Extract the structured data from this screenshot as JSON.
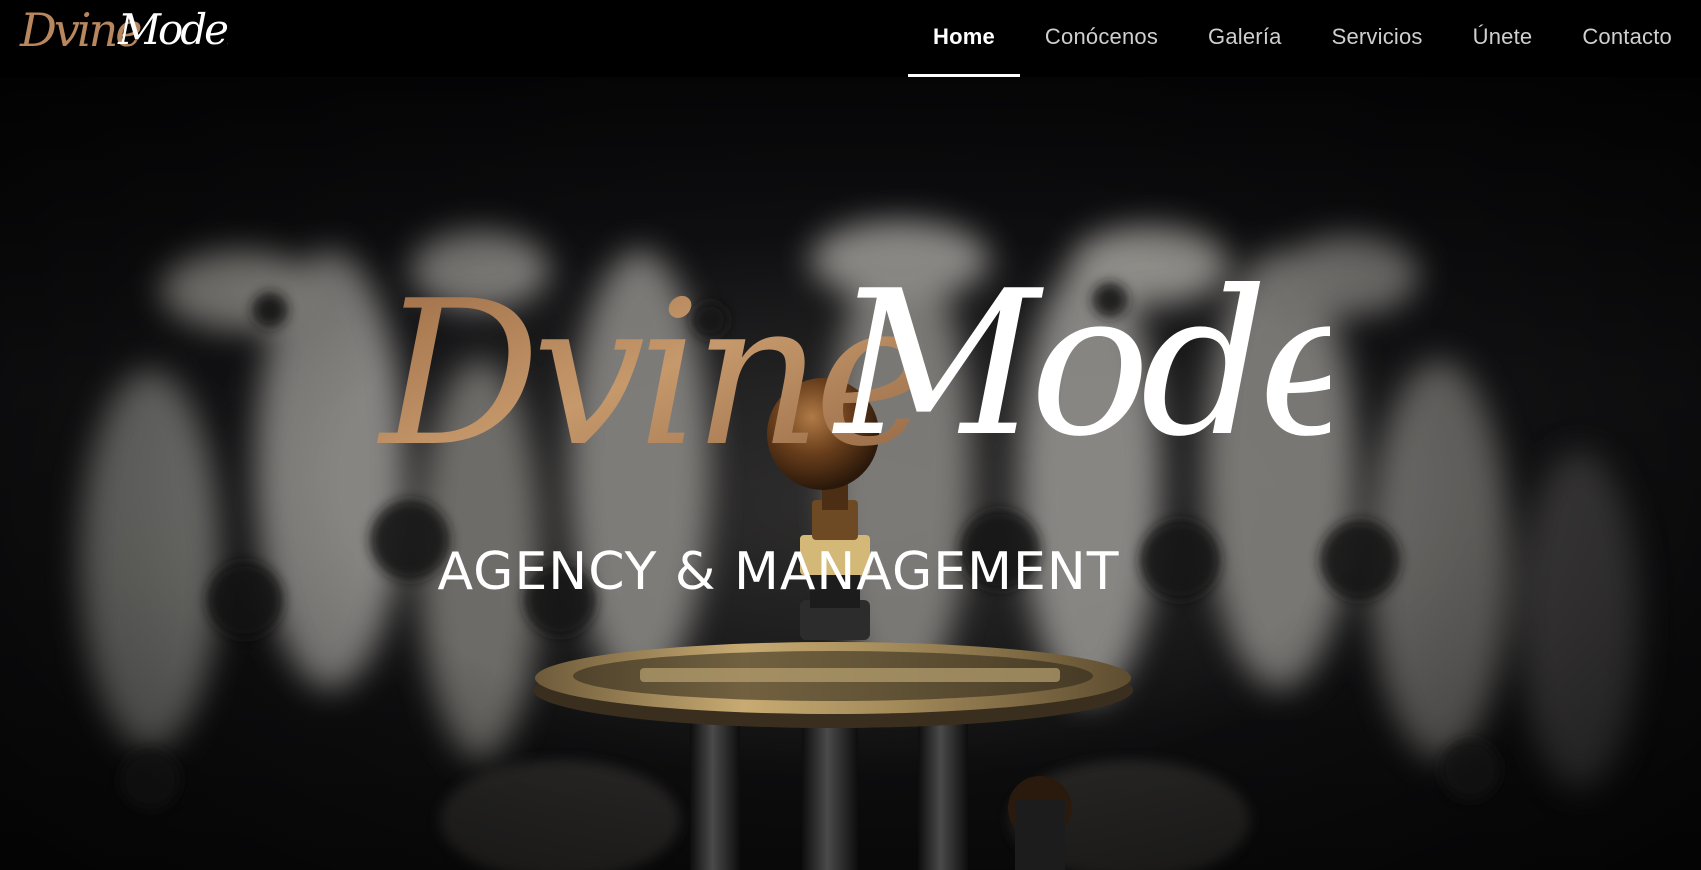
{
  "brand": {
    "logo_part1": "Dvine",
    "logo_part2": "Models",
    "tagline": "AGENCY & MANAGEMENT"
  },
  "nav": {
    "items": [
      {
        "label": "Home",
        "active": true
      },
      {
        "label": "Conócenos",
        "active": false
      },
      {
        "label": "Galería",
        "active": false
      },
      {
        "label": "Servicios",
        "active": false
      },
      {
        "label": "Únete",
        "active": false
      },
      {
        "label": "Contacto",
        "active": false
      }
    ]
  },
  "colors": {
    "header_bg": "#000000",
    "nav_text": "#cfcfcf",
    "nav_active": "#ffffff",
    "logo_gold": "#b8875e",
    "logo_white": "#ffffff"
  }
}
